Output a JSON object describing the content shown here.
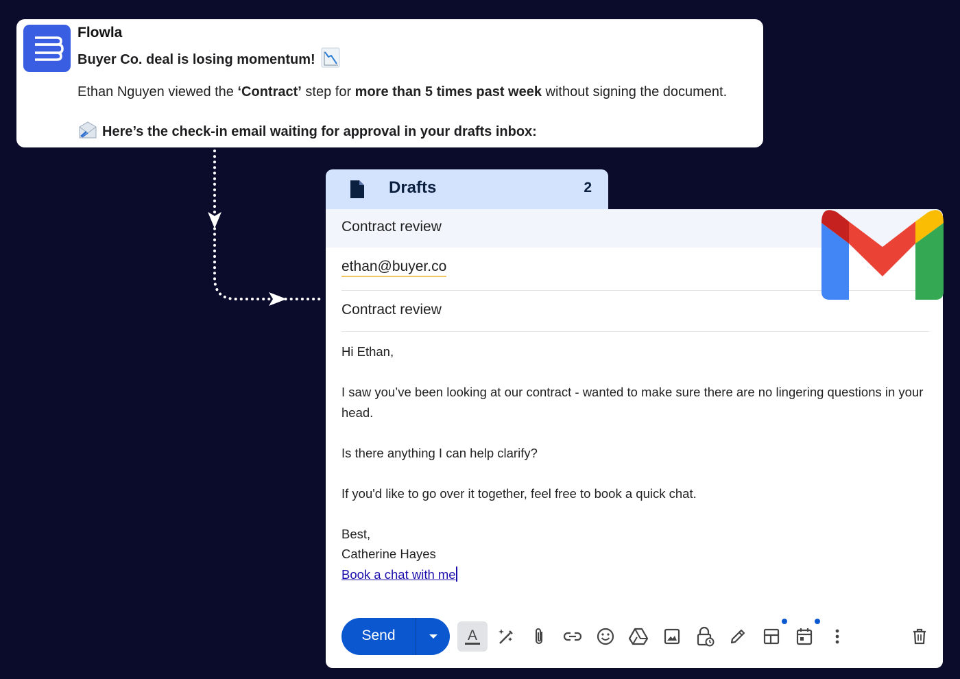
{
  "notification": {
    "app_name": "Flowla",
    "headline": "Buyer Co. deal is losing momentum!",
    "headline_emoji": "📉",
    "body_parts": {
      "p1": "Ethan Nguyen viewed the ",
      "p2": "‘Contract’",
      "p3": " step for ",
      "p4": "more than 5 times past week",
      "p5": " without signing the document."
    },
    "cta_emoji": "📨",
    "cta_text": "Here’s the check-in email waiting for approval in your drafts inbox:"
  },
  "drafts": {
    "label": "Drafts",
    "count": "2"
  },
  "compose": {
    "title": "Contract review",
    "to": "ethan@buyer.co",
    "subject": "Contract review",
    "body": {
      "greeting": "Hi Ethan,",
      "para1": "I saw you’ve been looking at our contract - wanted to make sure there are no lingering questions in your head.",
      "para2": "Is there anything I can help clarify?",
      "para3": "If you'd like to go over it together, feel free to book a quick chat.",
      "signoff": "Best,",
      "signature": "Catherine Hayes",
      "link": "Book a chat with me"
    },
    "send_label": "Send"
  },
  "icons": {
    "app": "flowla-logo-icon",
    "drafts": "file-icon",
    "toolbar": [
      "formatting-icon",
      "ai-assist-icon",
      "attach-icon",
      "link-icon",
      "emoji-icon",
      "drive-icon",
      "photo-icon",
      "confidential-lock-icon",
      "signature-pen-icon",
      "layout-template-icon",
      "schedule-calendar-icon",
      "more-vert-icon",
      "trash-icon"
    ]
  },
  "colors": {
    "background": "#0b0b2c",
    "brand": "#3a5ee2",
    "send": "#0b57d0",
    "drafts_tab": "#d3e3fd"
  }
}
